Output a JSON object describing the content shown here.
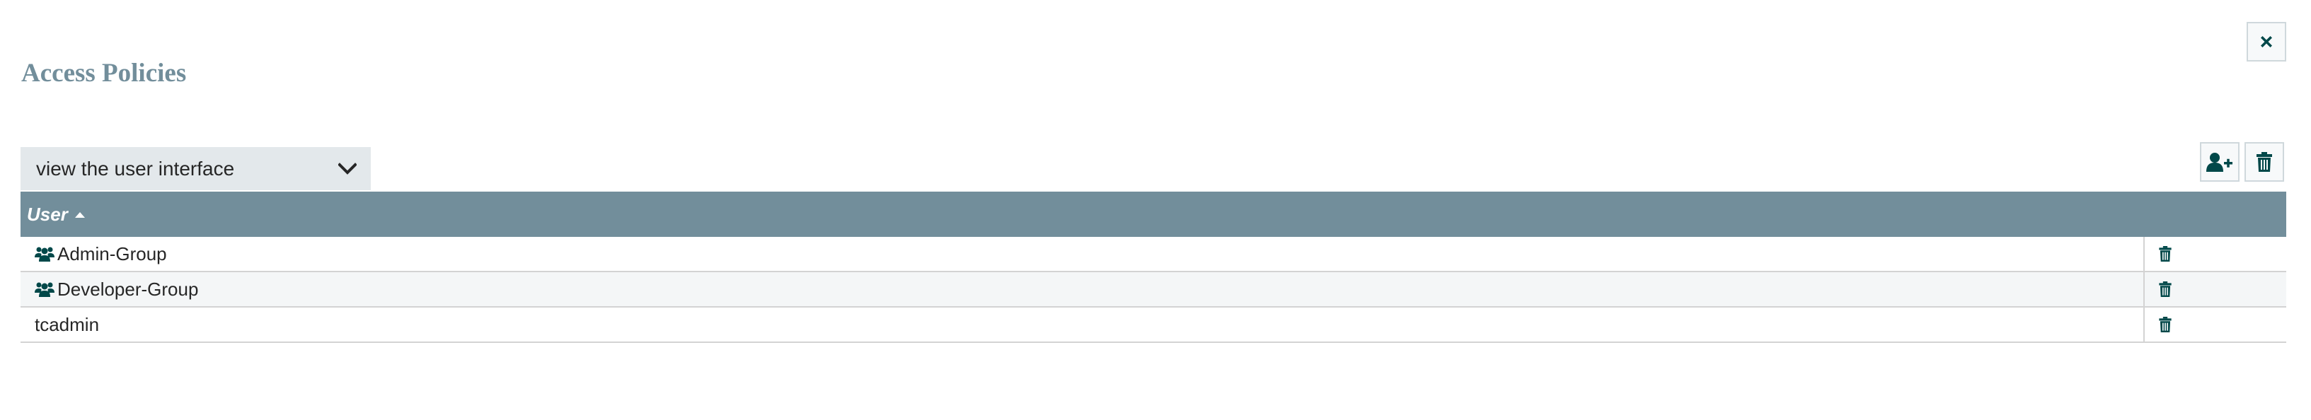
{
  "dialog": {
    "title": "Access Policies",
    "close_icon": "close-icon"
  },
  "policy_select": {
    "selected": "view the user interface",
    "icon": "chevron-down-icon"
  },
  "toolbar": {
    "add_user_icon": "user-plus-icon",
    "delete_icon": "trash-icon"
  },
  "table": {
    "columns": [
      "User"
    ],
    "sort": "ascending",
    "rows": [
      {
        "name": "Admin-Group",
        "type": "group"
      },
      {
        "name": "Developer-Group",
        "type": "group"
      },
      {
        "name": "tcadmin",
        "type": "user"
      }
    ]
  },
  "colors": {
    "header_bg": "#728e9b",
    "title": "#728e9b",
    "icon": "#004849",
    "select_bg": "#e3e8eb"
  }
}
